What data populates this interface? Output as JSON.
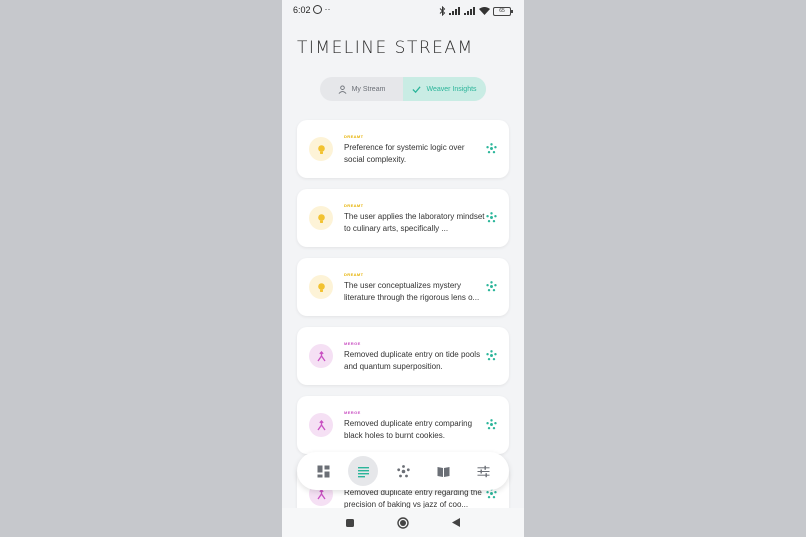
{
  "status_bar": {
    "time": "6:02",
    "extra": "··",
    "battery": "65"
  },
  "page": {
    "title": "TIMELINE STREAM"
  },
  "tabs": [
    {
      "label": "My Stream",
      "active": false
    },
    {
      "label": "Weaver Insights",
      "active": true
    }
  ],
  "cards": [
    {
      "type": "DREAMT",
      "text": "Preference for systemic logic over social complexity."
    },
    {
      "type": "DREAMT",
      "text": "The user applies the laboratory mindset to culinary arts, specifically ..."
    },
    {
      "type": "DREAMT",
      "text": "The user conceptualizes mystery literature through the rigorous lens o..."
    },
    {
      "type": "MERGE",
      "text": "Removed duplicate entry on tide pools and quantum superposition."
    },
    {
      "type": "MERGE",
      "text": "Removed duplicate entry comparing black holes to burnt cookies."
    },
    {
      "type": "MERGE",
      "text": "Removed duplicate entry regarding the precision of baking vs jazz of coo..."
    }
  ],
  "nav": {
    "items": [
      "dashboard-icon",
      "stream-icon",
      "graph-icon",
      "library-icon",
      "settings-icon"
    ],
    "active": "stream-icon"
  },
  "colors": {
    "accent": "#2bb59a",
    "dreamt": "#f2c230",
    "merge": "#c94fc2"
  }
}
